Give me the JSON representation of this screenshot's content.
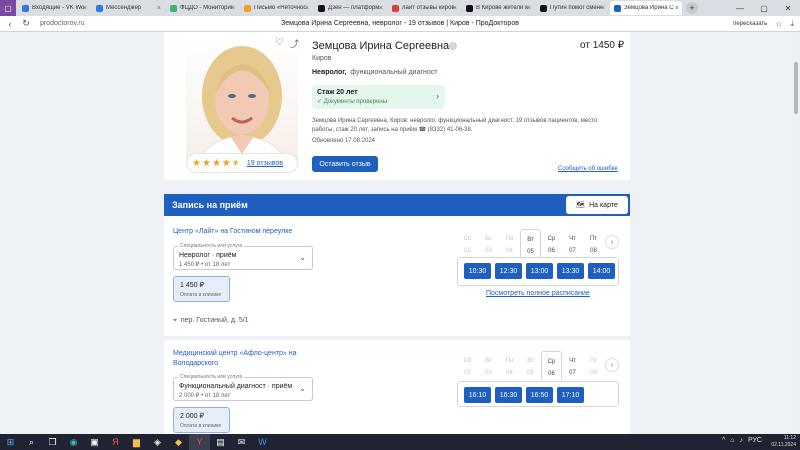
{
  "browser": {
    "tabs": [
      {
        "label": "Входящие - VK WorkM",
        "color": "#2f7be6"
      },
      {
        "label": "Мессенджер",
        "color": "#2f7be6"
      },
      {
        "label": "ФЦДО - Мониторинг",
        "color": "#3cb46e"
      },
      {
        "label": "Письмо «Неточност",
        "color": "#f0a21a"
      },
      {
        "label": "Дзен — платформа д",
        "color": "#111111"
      },
      {
        "label": "лайт отзывы киров",
        "color": "#e23b3b"
      },
      {
        "label": "В Кирове жители мн",
        "color": "#111111"
      },
      {
        "label": "Путин помог смене",
        "color": "#111111"
      },
      {
        "label": "Земцова Ирина С",
        "color": "#1f5fbf",
        "active": true
      }
    ],
    "url": "prodoctorov.ru",
    "page_title": "Земцова Ирина Сергеевна, невролог - 19 отзывов | Киров - ПроДокторов",
    "share_label": "пересказать"
  },
  "doctor": {
    "name": "Земцова Ирина Сергеевна",
    "price": "от 1450 ₽",
    "city": "Киров",
    "spec_main": "Невролог,",
    "spec_other": "функциональный диагност",
    "experience": "Стаж 20 лет",
    "docs_checked": "Документы проверены",
    "about": "Земцова Ирина Сергеевна, Киров: невролог, функциональный диагност, 19 отзывов пациентов, место работы, стаж 20 лет, запись на приём ☎ (8332) 41-06-38.",
    "updated": "Обновлено 17.08.2024",
    "rating": 4.5,
    "reviews_link": "19 отзывов",
    "review_button": "Оставить отзыв",
    "report_link": "Сообщить об ошибке"
  },
  "booking": {
    "title": "Запись на приём",
    "map_button": "На карте",
    "clinics": [
      {
        "name": "Центр «Лайт» на Гостином переулке",
        "select_legend": "Специальность или услуга",
        "select_value": "Невролог · приём",
        "select_sub": "1 450 ₽  •  от 18 лет",
        "price": "1 450 ₽",
        "price_note": "Оплата в клинике",
        "address": "пер. Гостиный, д. 5/1",
        "days": [
          {
            "dow": "Сб",
            "num": "02",
            "active": false
          },
          {
            "dow": "Вс",
            "num": "03",
            "active": false
          },
          {
            "dow": "Пн",
            "num": "04",
            "active": false
          },
          {
            "dow": "Вт",
            "num": "05",
            "active": true,
            "selected": true
          },
          {
            "dow": "Ср",
            "num": "06",
            "active": true
          },
          {
            "dow": "Чт",
            "num": "07",
            "active": true
          },
          {
            "dow": "Пт",
            "num": "08",
            "active": true
          }
        ],
        "slots": [
          "10:30",
          "12:30",
          "13:00",
          "13:30",
          "14:00"
        ],
        "full_schedule": "Посмотреть полное расписание"
      },
      {
        "name": "Медицинский центр «Афло-центр» на Володарского",
        "select_legend": "Специальность или услуга",
        "select_value": "Функциональный диагност · приём",
        "select_sub": "2 000 ₽  •  от 18 лет",
        "price": "2 000 ₽",
        "price_note": "Оплата в клинике",
        "days": [
          {
            "dow": "Сб",
            "num": "02",
            "active": false
          },
          {
            "dow": "Вс",
            "num": "03",
            "active": false
          },
          {
            "dow": "Пн",
            "num": "04",
            "active": false
          },
          {
            "dow": "Вт",
            "num": "05",
            "active": false
          },
          {
            "dow": "Ср",
            "num": "06",
            "active": true,
            "selected": true
          },
          {
            "dow": "Чт",
            "num": "07",
            "active": true
          },
          {
            "dow": "Пт",
            "num": "08",
            "active": false
          }
        ],
        "slots": [
          "16:10",
          "16:30",
          "16:50",
          "17:10"
        ]
      }
    ]
  },
  "taskbar": {
    "lang": "РУС",
    "time": "11:12",
    "date": "02.11.2024"
  }
}
